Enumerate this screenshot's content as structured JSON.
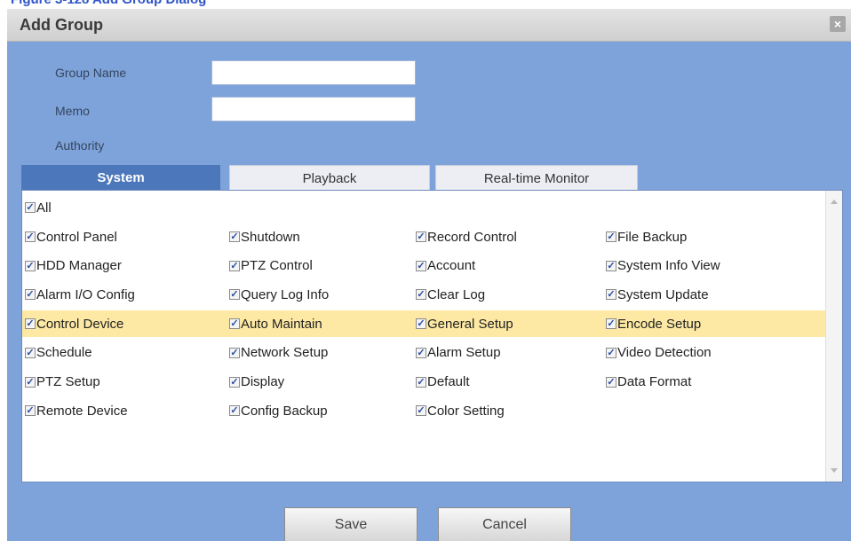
{
  "page_header": {
    "text": "Figure 3-128 Add Group Dialog"
  },
  "dialog": {
    "title": "Add Group",
    "close_icon": "close-icon",
    "group_name": {
      "label": "Group Name",
      "value": ""
    },
    "memo": {
      "label": "Memo",
      "value": ""
    },
    "authority_label": "Authority",
    "tabs": [
      {
        "label": "System",
        "active": true
      },
      {
        "label": "Playback",
        "active": false
      },
      {
        "label": "Real-time Monitor",
        "active": false
      }
    ],
    "highlight_color": "#fde9a4",
    "all_label": "All",
    "permissions": [
      [
        "Control Panel",
        "Shutdown",
        "Record Control",
        "File Backup"
      ],
      [
        "HDD Manager",
        "PTZ Control",
        "Account",
        "System Info View"
      ],
      [
        "Alarm I/O Config",
        "Query Log Info",
        "Clear Log",
        "System Update"
      ],
      [
        "Control Device",
        "Auto Maintain",
        "General Setup",
        "Encode Setup"
      ],
      [
        "Schedule",
        "Network Setup",
        "Alarm Setup",
        "Video Detection"
      ],
      [
        "PTZ Setup",
        "Display",
        "Default",
        "Data Format"
      ],
      [
        "Remote Device",
        "Config Backup",
        "Color Setting"
      ]
    ],
    "buttons": {
      "save": "Save",
      "cancel": "Cancel"
    }
  }
}
